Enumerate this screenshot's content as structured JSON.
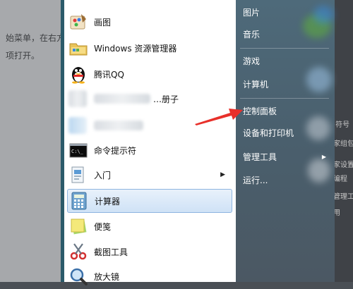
{
  "background_doc": {
    "line1": "始菜单，在右方",
    "line2": "项打开。"
  },
  "right_fragments": [
    "·符号",
    "家组包",
    "家设置",
    "编程",
    "管理工",
    "用"
  ],
  "left_items": [
    {
      "label": "画图",
      "icon": "paint-icon"
    },
    {
      "label": "Windows 资源管理器",
      "icon": "folder-explorer-icon"
    },
    {
      "label": "腾讯QQ",
      "icon": "qq-penguin-icon"
    },
    {
      "label": "…册子",
      "icon": "blurred-app-icon"
    },
    {
      "label": "",
      "icon": "blurred-app-icon"
    },
    {
      "label": "命令提示符",
      "icon": "cmd-icon"
    },
    {
      "label": "入门",
      "icon": "getting-started-icon",
      "has_submenu": true
    },
    {
      "label": "计算器",
      "icon": "calculator-icon",
      "selected": true
    },
    {
      "label": "便笺",
      "icon": "sticky-notes-icon"
    },
    {
      "label": "截图工具",
      "icon": "snipping-tool-icon"
    },
    {
      "label": "放大镜",
      "icon": "magnifier-icon"
    }
  ],
  "right_items": [
    {
      "label": "图片"
    },
    {
      "label": "音乐"
    },
    {
      "label": "游戏"
    },
    {
      "label": "计算机"
    },
    {
      "label": "控制面板"
    },
    {
      "label": "设备和打印机"
    },
    {
      "label": "管理工具",
      "has_submenu": true
    },
    {
      "label": "运行..."
    }
  ],
  "colors": {
    "annotation_arrow": "#e8302a",
    "selection_border": "#8eb5e0",
    "right_pane": "#4e6a7a"
  }
}
